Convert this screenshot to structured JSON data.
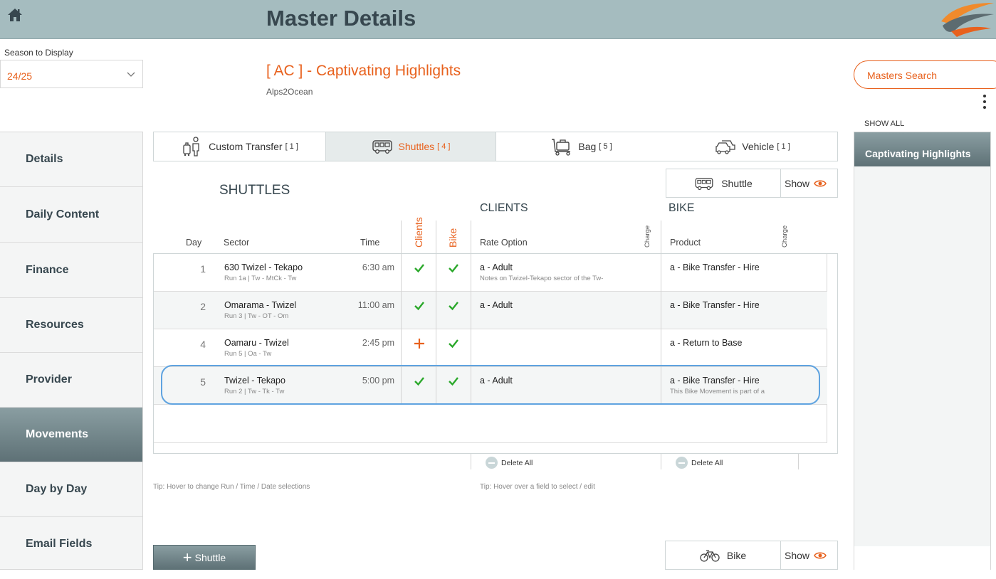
{
  "header": {
    "title": "Master Details"
  },
  "season": {
    "label": "Season to Display",
    "value": "24/25"
  },
  "master": {
    "title": "[ AC ] - Captivating Highlights",
    "subtitle": "Alps2Ocean"
  },
  "search": {
    "label": "Masters Search"
  },
  "right_panel": {
    "show_all": "SHOW ALL",
    "items": [
      "Captivating Highlights"
    ]
  },
  "sidebar": {
    "items": [
      "Details",
      "Daily Content",
      "Finance",
      "Resources",
      "Provider",
      "Movements",
      "Day by Day",
      "Email Fields"
    ],
    "active": "Movements"
  },
  "tabs": [
    {
      "label": "Custom Transfer",
      "count": "[ 1 ]",
      "icon": "person-transfer-icon"
    },
    {
      "label": "Shuttles",
      "count": "[ 4 ]",
      "icon": "bus-icon"
    },
    {
      "label": "Bag",
      "count": "[ 5 ]",
      "icon": "bag-trolley-icon"
    },
    {
      "label": "Vehicle",
      "count": "[ 1 ]",
      "icon": "car-icon"
    }
  ],
  "shuttle_toggle": {
    "label": "Shuttle",
    "show": "Show"
  },
  "bike_toggle": {
    "label": "Bike",
    "show": "Show"
  },
  "sections": {
    "shuttles": "SHUTTLES",
    "clients": "CLIENTS",
    "bike": "BIKE"
  },
  "columns": {
    "day": "Day",
    "sector": "Sector",
    "time": "Time",
    "clients": "Clients",
    "bike": "Bike",
    "rate_option": "Rate Option",
    "charge": "Charge",
    "product": "Product"
  },
  "rows": [
    {
      "day": "1",
      "sector": "630 Twizel - Tekapo",
      "run": "Run 1a | Tw - MtCk - Tw",
      "time": "6:30 am",
      "clients": "check",
      "bike": "check",
      "rate": "a - Adult",
      "note": "Notes on Twizel-Tekapo sector of the Tw-",
      "product": "a - Bike Transfer - Hire",
      "pnote": ""
    },
    {
      "day": "2",
      "sector": "Omarama - Twizel",
      "run": "Run 3 | Tw - OT - Om",
      "time": "11:00 am",
      "clients": "check",
      "bike": "check",
      "rate": "a - Adult",
      "note": "",
      "product": "a - Bike Transfer - Hire",
      "pnote": ""
    },
    {
      "day": "4",
      "sector": "Oamaru - Twizel",
      "run": "Run 5 | Oa - Tw",
      "time": "2:45 pm",
      "clients": "plus",
      "bike": "check",
      "rate": "",
      "note": "",
      "product": "a - Return to Base",
      "pnote": ""
    },
    {
      "day": "5",
      "sector": "Twizel - Tekapo",
      "run": "Run 2 | Tw - Tk - Tw",
      "time": "5:00 pm",
      "clients": "check",
      "bike": "check",
      "rate": "a - Adult",
      "note": "",
      "product": "a - Bike Transfer - Hire",
      "pnote": "This Bike Movement is part of a"
    }
  ],
  "delete_all": "Delete All",
  "tips": {
    "left": "Tip: Hover to change Run / Time / Date selections",
    "right": "Tip: Hover over a field to select / edit"
  },
  "add_button": {
    "label": "Shuttle"
  },
  "colors": {
    "accent": "#e8611d",
    "check": "#2aa82a",
    "header": "#a5bcbf"
  }
}
